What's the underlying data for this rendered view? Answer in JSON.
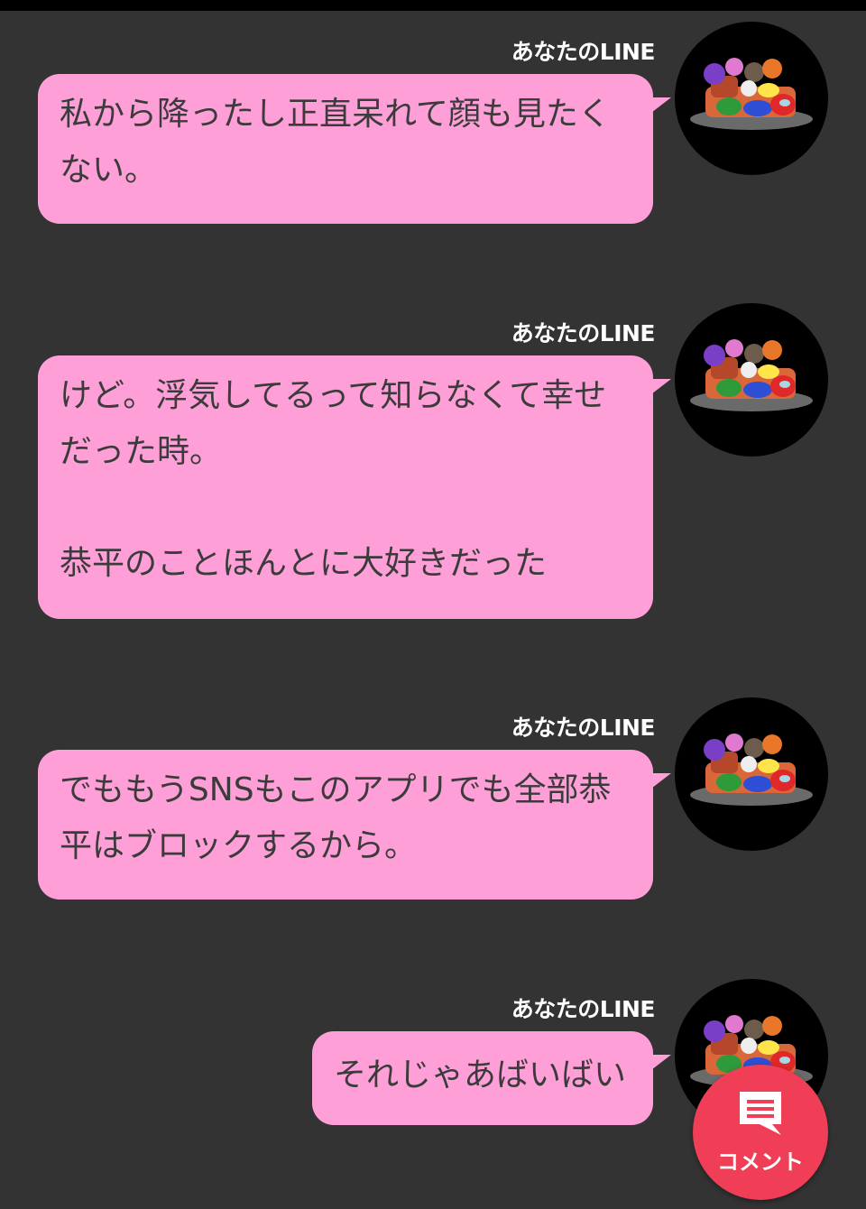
{
  "messages": [
    {
      "sender": "あなたのLINE",
      "text": "私から降ったし正直呆れて顔も見たくない。",
      "avatar": "among-us-avatar"
    },
    {
      "sender": "あなたのLINE",
      "text": "けど。浮気してるって知らなくて幸せだった時。\n\n恭平のことほんとに大好きだった",
      "avatar": "among-us-avatar"
    },
    {
      "sender": "あなたのLINE",
      "text": "でももうSNSもこのアプリでも全部恭平はブロックするから。",
      "avatar": "among-us-avatar"
    },
    {
      "sender": "あなたのLINE",
      "text": "それじゃあばいばい",
      "avatar": "among-us-avatar"
    }
  ],
  "fab": {
    "label": "コメント",
    "icon": "comment-icon"
  },
  "colors": {
    "background": "#333333",
    "bubble": "#ff9fd8",
    "bubble_text": "#3b3b3b",
    "sender_text": "#ffffff",
    "fab": "#ef3e55"
  }
}
